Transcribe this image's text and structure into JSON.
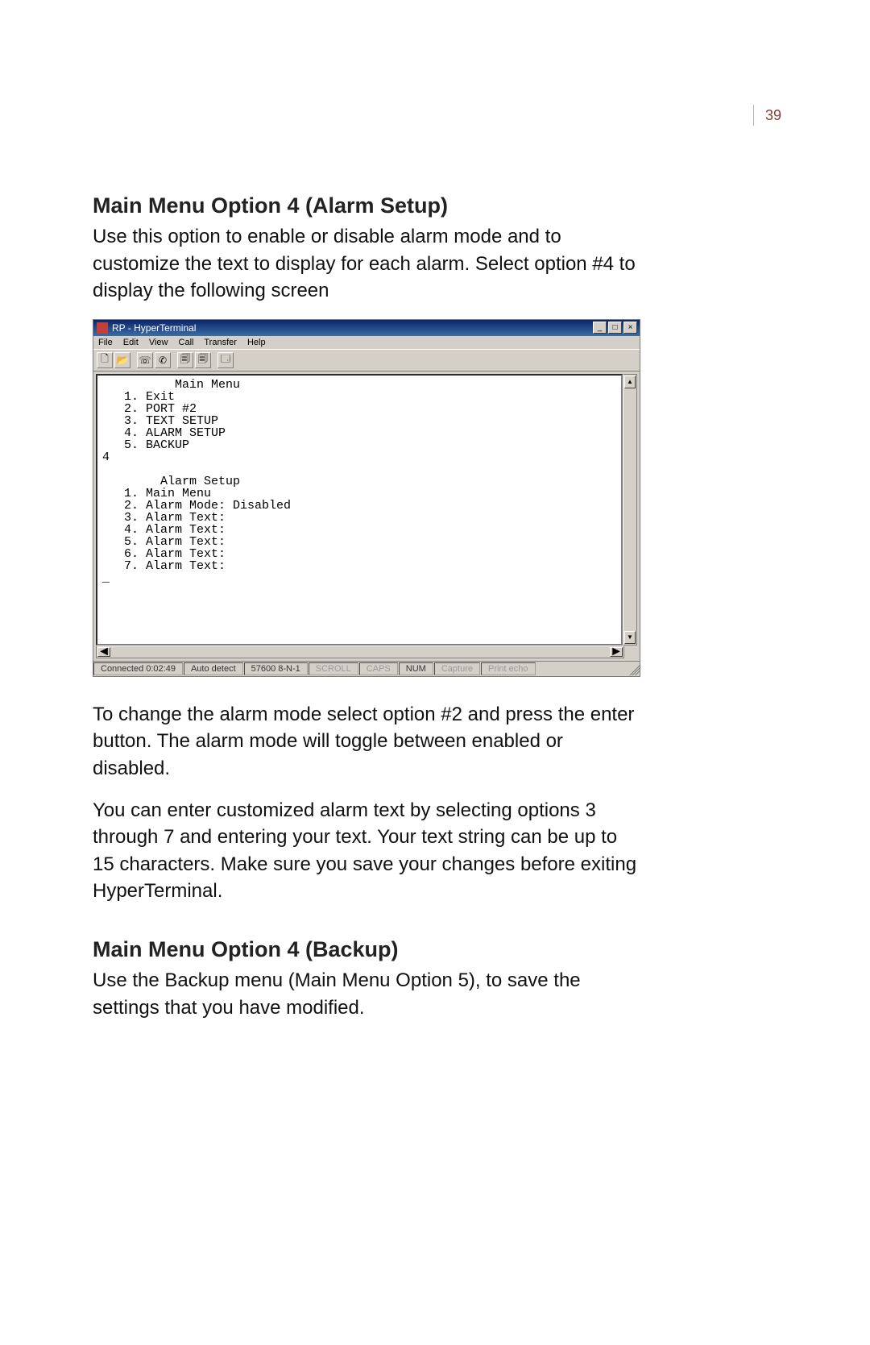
{
  "page_number": "39",
  "section1": {
    "heading": "Main Menu Option 4 (Alarm Setup)",
    "para1": "Use this option to enable or disable alarm mode and to customize the text to display for each alarm. Select option #4 to display the following screen",
    "para2": "To change the alarm mode select option #2 and press the enter button. The alarm mode will toggle between enabled or disabled.",
    "para3": "You can enter customized alarm text by selecting options 3 through 7 and entering your text. Your text string can be up to 15 characters. Make sure you save your changes before exiting HyperTerminal."
  },
  "section2": {
    "heading": "Main Menu Option 4 (Backup)",
    "para1": "Use the Backup menu (Main Menu Option 5), to save the settings that you have modified."
  },
  "screenshot": {
    "title": "RP - HyperTerminal",
    "menus": [
      "File",
      "Edit",
      "View",
      "Call",
      "Transfer",
      "Help"
    ],
    "terminal_text": "          Main Menu\n   1. Exit\n   2. PORT #2\n   3. TEXT SETUP\n   4. ALARM SETUP\n   5. BACKUP\n4\n\n        Alarm Setup\n   1. Main Menu\n   2. Alarm Mode: Disabled\n   3. Alarm Text:\n   4. Alarm Text:\n   5. Alarm Text:\n   6. Alarm Text:\n   7. Alarm Text:\n_",
    "status": {
      "connected": "Connected 0:02:49",
      "detect": "Auto detect",
      "port": "57600 8-N-1",
      "scroll": "SCROLL",
      "caps": "CAPS",
      "num": "NUM",
      "capture": "Capture",
      "echo": "Print echo"
    }
  }
}
